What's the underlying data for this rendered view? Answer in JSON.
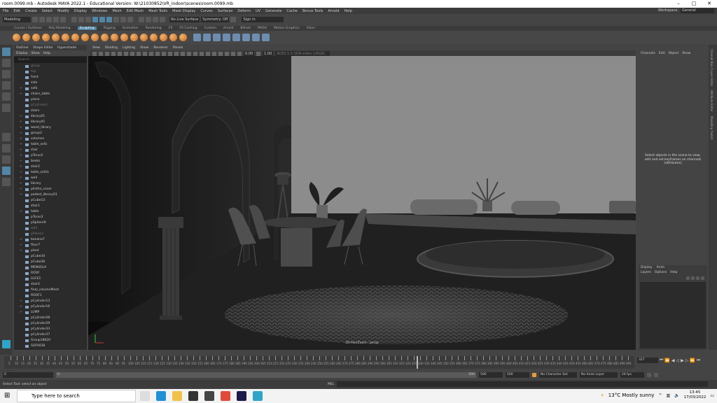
{
  "window": {
    "title": "room.0099.mb - Autodesk MAYA 2022.1 - Educational Version: W:\\21030852\\VR_indoor\\scenes\\room.0099.mb"
  },
  "menubar": {
    "items": [
      "File",
      "Edit",
      "Create",
      "Select",
      "Modify",
      "Display",
      "Windows",
      "Mesh",
      "Edit Mesh",
      "Mesh Tools",
      "Mesh Display",
      "Curves",
      "Surfaces",
      "Deform",
      "UV",
      "Generate",
      "Cache",
      "Bonus Tools",
      "Arnold",
      "Help"
    ],
    "workspace_label": "Workspace:",
    "workspace_value": "General"
  },
  "statusline": {
    "mode": "Modeling",
    "live_surface": "No Live Surface",
    "symmetry": "Symmetry: Off",
    "sign_in": "Sign In"
  },
  "shelf": {
    "tabs": [
      "Curves / Surfaces",
      "Poly Modeling",
      "Sculpting",
      "Rigging",
      "Animation",
      "Rendering",
      "FX",
      "FX Caching",
      "Custom",
      "Arnold",
      "Bifrost",
      "MASH",
      "Motion Graphics",
      "XGen"
    ],
    "active_tab": "Sculpting"
  },
  "outliner": {
    "tabs": [
      "Outliner",
      "Shape Editor",
      "Hypershade"
    ],
    "menu": [
      "Display",
      "Show",
      "Help"
    ],
    "search_placeholder": "Search...",
    "items": [
      {
        "label": "group",
        "dim": true,
        "exp": false
      },
      {
        "label": "top",
        "dim": true,
        "exp": false
      },
      {
        "label": "front",
        "dim": false,
        "exp": false
      },
      {
        "label": "side",
        "dim": false,
        "exp": false
      },
      {
        "label": "sofa",
        "dim": false,
        "exp": true
      },
      {
        "label": "chairs_table",
        "dim": false,
        "exp": true
      },
      {
        "label": "piano",
        "dim": false,
        "exp": false
      },
      {
        "label": "pCylinder1",
        "dim": true,
        "exp": false
      },
      {
        "label": "stairs",
        "dim": false,
        "exp": false
      },
      {
        "label": "library01",
        "dim": false,
        "exp": true
      },
      {
        "label": "library01",
        "dim": false,
        "exp": true
      },
      {
        "label": "wood_library",
        "dim": false,
        "exp": true
      },
      {
        "label": "group2",
        "dim": false,
        "exp": true
      },
      {
        "label": "columns",
        "dim": false,
        "exp": true
      },
      {
        "label": "table_sofa",
        "dim": false,
        "exp": true
      },
      {
        "label": "stair",
        "dim": false,
        "exp": true
      },
      {
        "label": "pTorus2",
        "dim": false,
        "exp": true
      },
      {
        "label": "books",
        "dim": false,
        "exp": true
      },
      {
        "label": "stair2",
        "dim": false,
        "exp": true
      },
      {
        "label": "table_sofa1",
        "dim": false,
        "exp": true
      },
      {
        "label": "wall",
        "dim": false,
        "exp": true
      },
      {
        "label": "library",
        "dim": false,
        "exp": true
      },
      {
        "label": "plinths_cover",
        "dim": false,
        "exp": true
      },
      {
        "label": "pedest_library01",
        "dim": false,
        "exp": true
      },
      {
        "label": "pCube13",
        "dim": false,
        "exp": false
      },
      {
        "label": "stair1",
        "dim": false,
        "exp": false
      },
      {
        "label": "table",
        "dim": false,
        "exp": true
      },
      {
        "label": "pTorus3",
        "dim": false,
        "exp": false
      },
      {
        "label": "pSphere9",
        "dim": false,
        "exp": false
      },
      {
        "label": "wall",
        "dim": true,
        "exp": false
      },
      {
        "label": "pPlane2",
        "dim": true,
        "exp": false
      },
      {
        "label": "banana7",
        "dim": false,
        "exp": true
      },
      {
        "label": "flour7",
        "dim": false,
        "exp": true
      },
      {
        "label": "plant",
        "dim": false,
        "exp": true
      },
      {
        "label": "pCube34",
        "dim": false,
        "exp": false
      },
      {
        "label": "pCube36",
        "dim": false,
        "exp": false
      },
      {
        "label": "MENSOLA",
        "dim": false,
        "exp": false
      },
      {
        "label": "ROOF",
        "dim": false,
        "exp": false
      },
      {
        "label": "LUCE1",
        "dim": false,
        "exp": false
      },
      {
        "label": "stair4",
        "dim": false,
        "exp": false
      },
      {
        "label": "final_columnMesh",
        "dim": false,
        "exp": false
      },
      {
        "label": "ROOF1",
        "dim": false,
        "exp": false
      },
      {
        "label": "pCylinder13",
        "dim": false,
        "exp": true
      },
      {
        "label": "pCylinder16",
        "dim": false,
        "exp": true
      },
      {
        "label": "LUMP",
        "dim": false,
        "exp": true
      },
      {
        "label": "pCylinder28",
        "dim": false,
        "exp": false
      },
      {
        "label": "pCylinder29",
        "dim": false,
        "exp": false
      },
      {
        "label": "pCylinder33",
        "dim": false,
        "exp": false
      },
      {
        "label": "pCylinder37",
        "dim": false,
        "exp": false
      },
      {
        "label": "Group18620",
        "dim": false,
        "exp": false
      },
      {
        "label": "SOFA038",
        "dim": false,
        "exp": false
      }
    ]
  },
  "viewport": {
    "menu": [
      "View",
      "Shading",
      "Lighting",
      "Show",
      "Renderer",
      "Panels"
    ],
    "field_a": "0.00",
    "field_b": "1.00",
    "colorspace": "ACES 1.0 SDR-video (sRGB)",
    "camera_caption": "2D Pan/Zoom : persp"
  },
  "channelbox": {
    "menu": [
      "Channels",
      "Edit",
      "Object",
      "Show"
    ],
    "message": "Select objects in the scene to view, edit and set keyframes on channels (attributes)"
  },
  "layers": {
    "tabs": [
      "Display",
      "Anim"
    ],
    "menu": [
      "Layers",
      "Options",
      "Help"
    ]
  },
  "rightstrip": [
    "Channel Box / Layer Editor",
    "Attribute Editor",
    "Modelling Toolkit"
  ],
  "timeline": {
    "ticks": [
      5,
      10,
      15,
      20,
      25,
      30,
      35,
      40,
      45,
      50,
      55,
      60,
      65,
      70,
      75,
      80,
      85,
      90,
      95,
      100,
      105,
      110,
      115,
      120,
      125,
      130,
      135,
      140,
      145,
      150,
      155,
      160,
      165,
      170,
      175,
      180,
      185,
      190,
      195,
      200,
      205,
      210,
      215,
      220,
      225,
      230,
      235,
      240,
      245,
      250,
      255,
      260,
      265,
      270,
      275,
      280,
      285,
      290,
      295,
      300,
      305,
      310,
      315,
      320,
      325,
      330,
      335,
      340,
      345,
      350,
      355,
      360,
      365,
      370,
      375,
      380,
      385,
      390,
      395,
      400,
      405,
      410,
      415,
      420,
      425,
      430,
      435,
      440,
      445,
      450,
      455,
      460,
      465,
      470,
      475,
      480,
      485,
      490,
      495
    ],
    "current_frame": "327"
  },
  "rangebar": {
    "start": "0",
    "inner_start": "0",
    "inner_end": "500",
    "end_a": "500",
    "end_b": "500",
    "character_set": "No Character Set",
    "anim_layer": "No Anim Layer",
    "fps": "24 fps"
  },
  "helpline": {
    "message": "Select Tool: select an object",
    "mel_label": "MEL"
  },
  "taskbar": {
    "search_placeholder": "Type here to search",
    "weather": "13°C  Mostly sunny",
    "time": "13:45",
    "date": "17/03/2022"
  }
}
